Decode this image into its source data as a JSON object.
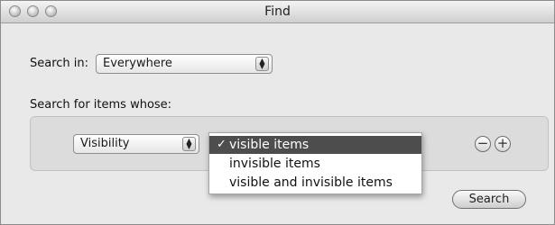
{
  "window": {
    "title": "Find"
  },
  "search_in": {
    "label": "Search in:",
    "value": "Everywhere"
  },
  "criteria": {
    "label": "Search for items whose:",
    "attribute_value": "Visibility",
    "remove_symbol": "−",
    "add_symbol": "+"
  },
  "menu": {
    "checkmark": "✓",
    "items": [
      {
        "label": "visible items",
        "selected": true
      },
      {
        "label": "invisible items",
        "selected": false
      },
      {
        "label": "visible and invisible items",
        "selected": false
      }
    ]
  },
  "actions": {
    "search_label": "Search"
  },
  "icons": {
    "popup_arrows": "updown-arrows-icon",
    "window_controls": [
      "close-icon",
      "minimize-icon",
      "zoom-icon"
    ]
  },
  "colors": {
    "menu_highlight": "#4d4d4d",
    "window_bg": "#e9e9e9"
  }
}
